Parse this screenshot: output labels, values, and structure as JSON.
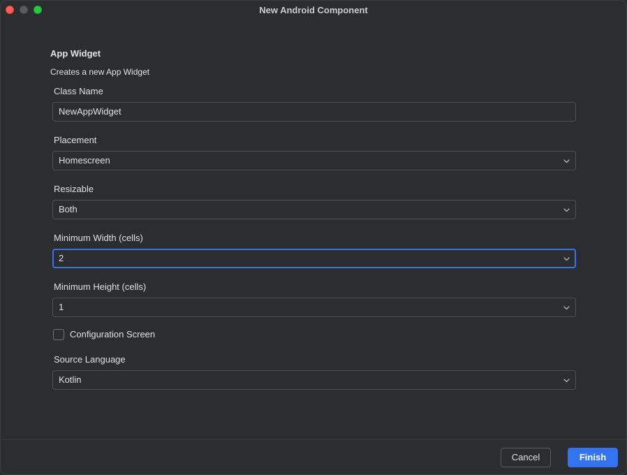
{
  "window": {
    "title": "New Android Component"
  },
  "section": {
    "title": "App Widget",
    "description": "Creates a new App Widget"
  },
  "fields": {
    "class_name": {
      "label": "Class Name",
      "value": "NewAppWidget"
    },
    "placement": {
      "label": "Placement",
      "value": "Homescreen"
    },
    "resizable": {
      "label": "Resizable",
      "value": "Both"
    },
    "min_width": {
      "label": "Minimum Width (cells)",
      "value": "2"
    },
    "min_height": {
      "label": "Minimum Height (cells)",
      "value": "1"
    },
    "config_screen": {
      "label": "Configuration Screen",
      "checked": false
    },
    "source_language": {
      "label": "Source Language",
      "value": "Kotlin"
    }
  },
  "footer": {
    "cancel_label": "Cancel",
    "finish_label": "Finish"
  },
  "icons": {
    "dropdown": "chevron-down-icon"
  },
  "colors": {
    "accent": "#3574f0",
    "close": "#fe5f57",
    "maximize": "#2ac840"
  }
}
